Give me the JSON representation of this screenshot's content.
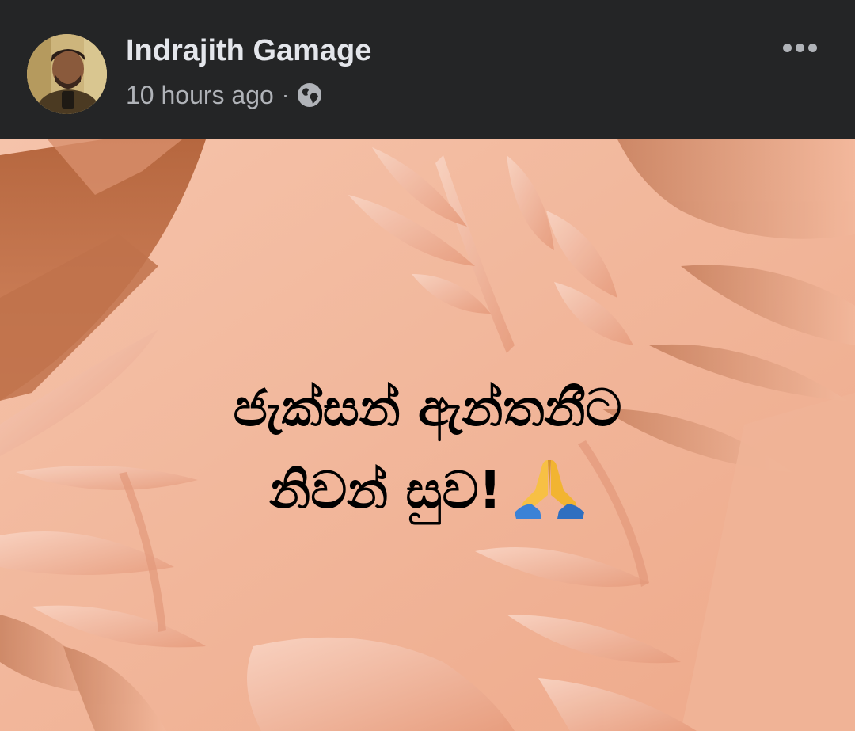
{
  "post": {
    "author": {
      "name": "Indrajith Gamage",
      "avatar_icon": "profile-photo"
    },
    "meta": {
      "time": "10 hours ago",
      "separator": "·",
      "privacy_icon": "globe-icon"
    },
    "more_icon": "ellipsis-icon",
    "content": {
      "line1": "ජැක්සන් ඇන්තනීට",
      "line2": "නිවන් සුව!",
      "emoji": "folded-hands-emoji"
    },
    "colors": {
      "header_bg": "#242526",
      "name": "#e4e6eb",
      "meta": "#b0b3b8",
      "post_bg": "#f2b79b"
    }
  }
}
